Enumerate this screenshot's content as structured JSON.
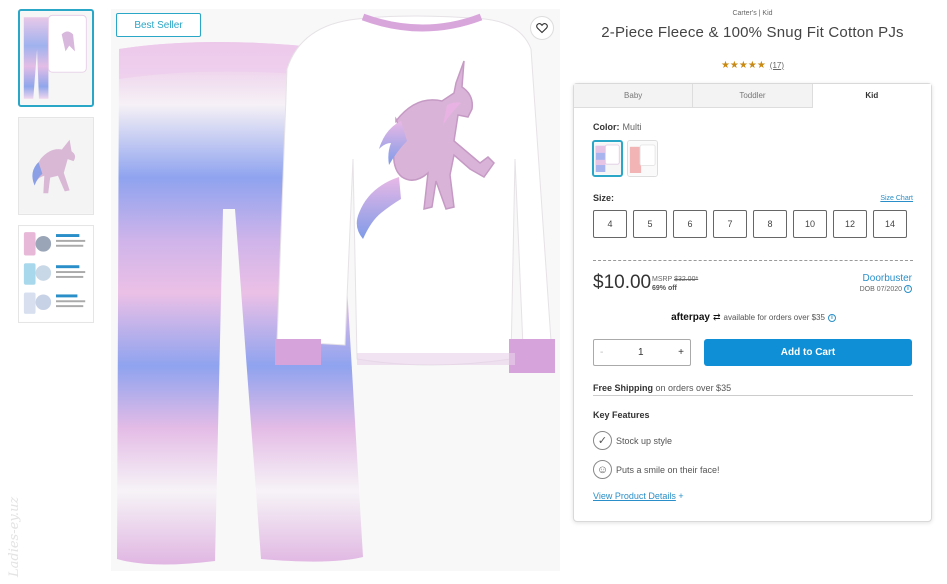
{
  "gallery": {
    "badge": "Best Seller",
    "thumbnails": [
      "front-view",
      "unicone-detail",
      "size-info"
    ],
    "thumb3_text": [
      "Jacquard-Fleece",
      "Jacquard-Fleece",
      "Cotton"
    ]
  },
  "watermark": "Ladies-ey.uz",
  "product": {
    "brand": "Carter's | Kid",
    "title": "2-Piece Fleece & 100% Snug Fit Cotton PJs",
    "stars": "★★★★★",
    "review_count": "(17)"
  },
  "tabs": [
    {
      "label": "Baby"
    },
    {
      "label": "Toddler"
    },
    {
      "label": "Kid"
    }
  ],
  "color": {
    "label": "Color:",
    "value": "Multi"
  },
  "size": {
    "label": "Size:",
    "chart_link": "Size Chart",
    "options": [
      "4",
      "5",
      "6",
      "7",
      "8",
      "10",
      "12",
      "14"
    ]
  },
  "pricing": {
    "price": "$10.00",
    "msrp_label": "MSRP",
    "msrp_value": "$32.00*",
    "discount": "69% off",
    "promo": "Doorbuster",
    "promo_date": "DOB 07/2020"
  },
  "afterpay": {
    "logo": "afterpay",
    "text": "available for orders over $35"
  },
  "quantity": {
    "minus": "-",
    "value": "1",
    "plus": "+"
  },
  "cart": {
    "button": "Add to Cart"
  },
  "shipping": {
    "bold": "Free Shipping",
    "rest": "on orders over $35"
  },
  "features": {
    "title": "Key Features",
    "items": [
      {
        "text": "Stock up style",
        "icon": "checkmark-icon"
      },
      {
        "text": "Puts a smile on their face!",
        "icon": "smiley-icon"
      }
    ],
    "details_link": "View Product Details",
    "details_plus": "+"
  },
  "colors": {
    "accent": "#2aa6c6",
    "button": "#0f8fd6",
    "link": "#2a8fc8",
    "stars": "#c98a14"
  }
}
